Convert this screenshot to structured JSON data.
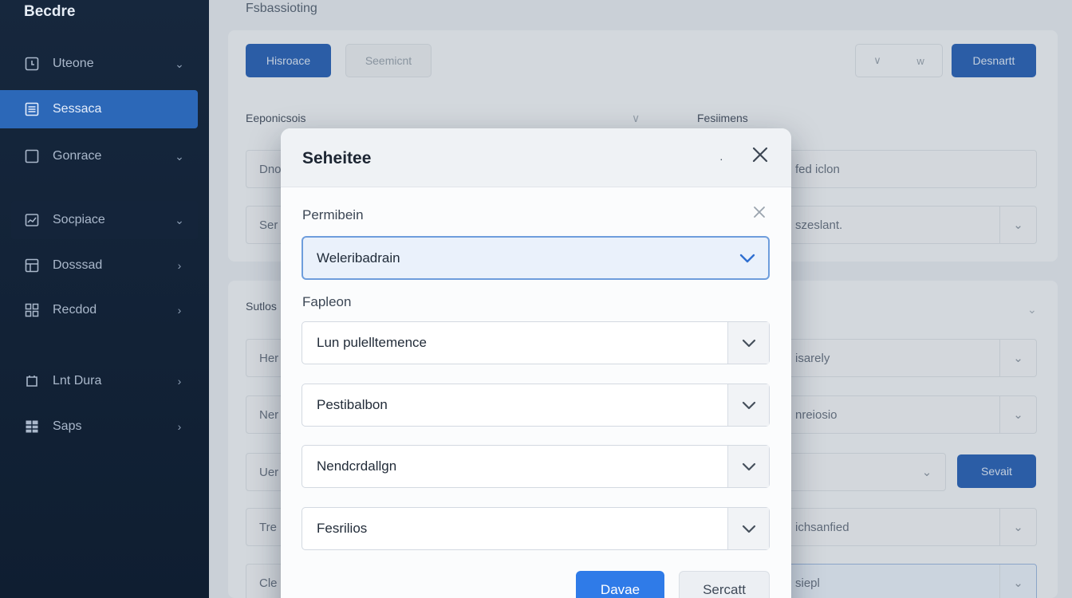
{
  "app": {
    "brand": "Becdre"
  },
  "sidebar": {
    "items": [
      {
        "label": "Uteone",
        "icon": "clock-icon",
        "chevron": "⌄"
      },
      {
        "label": "Sessaca",
        "icon": "list-icon",
        "chevron": ""
      },
      {
        "label": "Gonrace",
        "icon": "square-icon",
        "chevron": "⌄"
      },
      {
        "label": "Socpiace",
        "icon": "chart-icon",
        "chevron": "⌄"
      },
      {
        "label": "Dosssad",
        "icon": "grid-icon",
        "chevron": "›"
      },
      {
        "label": "Recdod",
        "icon": "apps-icon",
        "chevron": "›"
      },
      {
        "label": "Lnt Dura",
        "icon": "box-icon",
        "chevron": "›"
      },
      {
        "label": "Saps",
        "icon": "table-icon",
        "chevron": "›"
      }
    ]
  },
  "background": {
    "page_title": "Fsbassioting",
    "toolbar": {
      "primary_label": "Hisroace",
      "ghost_label": "Seemicnt",
      "seg_left": "∨",
      "seg_right": "w",
      "right_button_label": "Desnartt"
    },
    "section_left": "Eeponicsois",
    "section_right": "Fesiimens",
    "section_lower": "Sutlos",
    "left_fields": [
      "Dno",
      "Ser",
      "Her",
      "Ner",
      "Uer",
      "Tre",
      "Cle"
    ],
    "right_fields": [
      "fed iclon",
      "szeslant.",
      "isarely",
      "nreiosio",
      "",
      "ichsanfied",
      "siepl"
    ],
    "right_button_label": "Sevait"
  },
  "modal": {
    "title": "Seheitee",
    "header_dot": "·",
    "field1_label": "Permibein",
    "field1_value": "Weleribadrain",
    "field2_label": "Fapleon",
    "rows": [
      "Lun pulelltemence",
      "Pestibalbon",
      "Nendcrdallgn",
      "Fesrilios"
    ],
    "primary_label": "Davae",
    "secondary_label": "Sercatt"
  },
  "colors": {
    "sidebar_bg": "#16273d",
    "accent": "#2f7be8",
    "active_nav": "#2c68b8"
  }
}
